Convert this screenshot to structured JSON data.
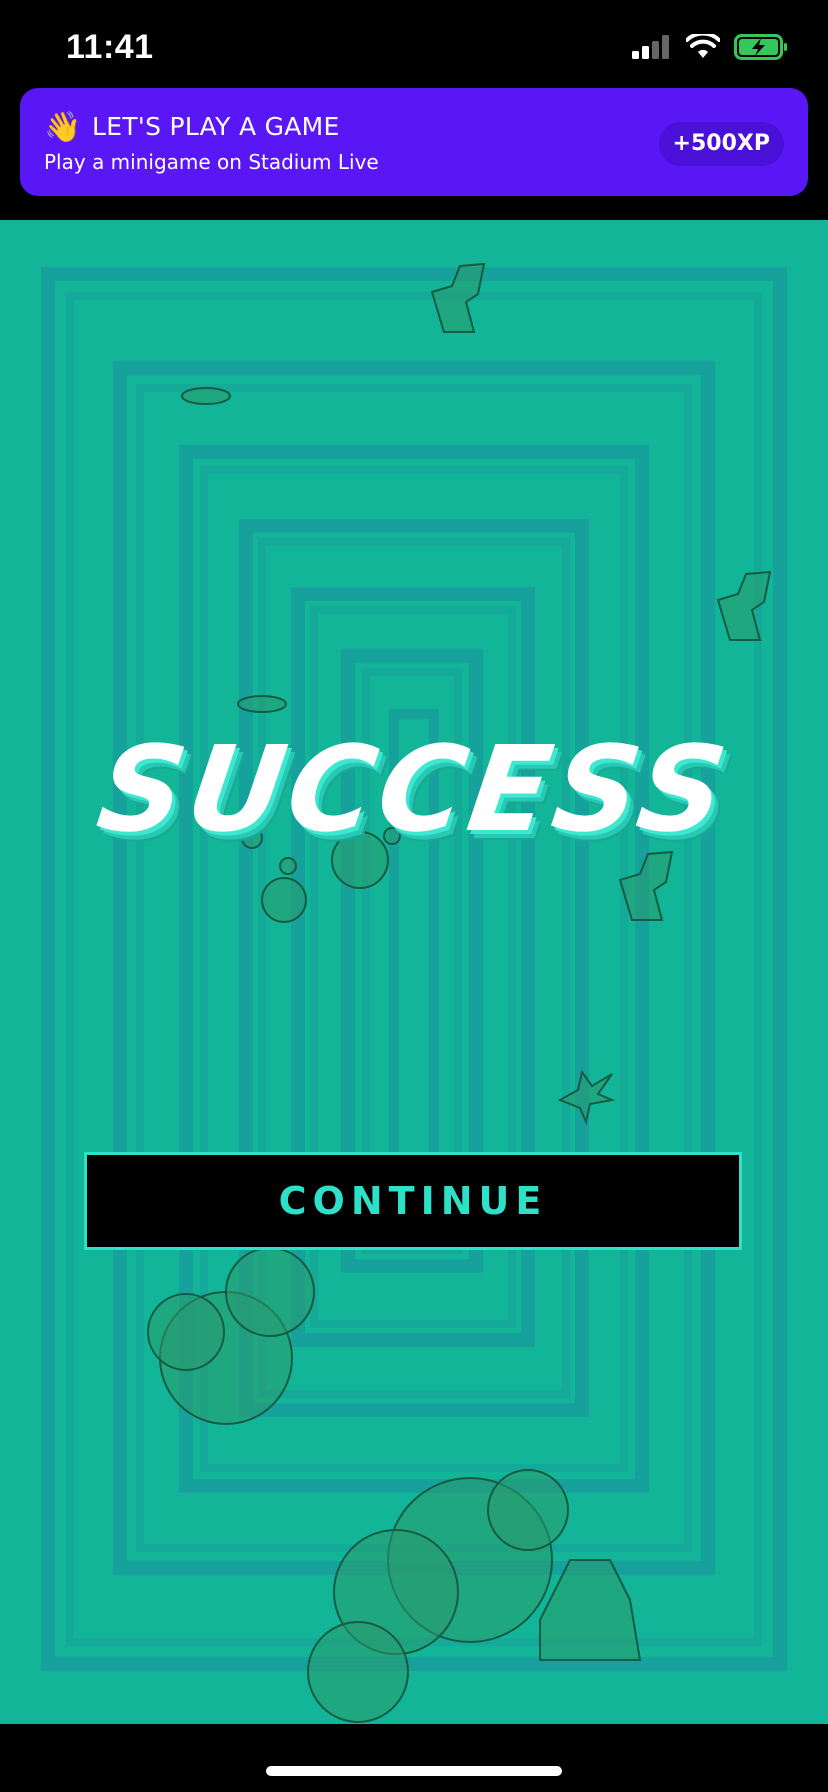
{
  "status_bar": {
    "time": "11:41"
  },
  "notification_banner": {
    "emoji": "👋",
    "title": "LET'S PLAY A GAME",
    "subtitle": "Play a minigame on Stadium Live",
    "reward": "+500XP"
  },
  "game": {
    "result_text": "SUCCESS",
    "continue_label": "CONTINUE"
  },
  "colors": {
    "banner_bg": "#5a17f5",
    "game_bg": "#12b597",
    "accent": "#2de0c8"
  }
}
